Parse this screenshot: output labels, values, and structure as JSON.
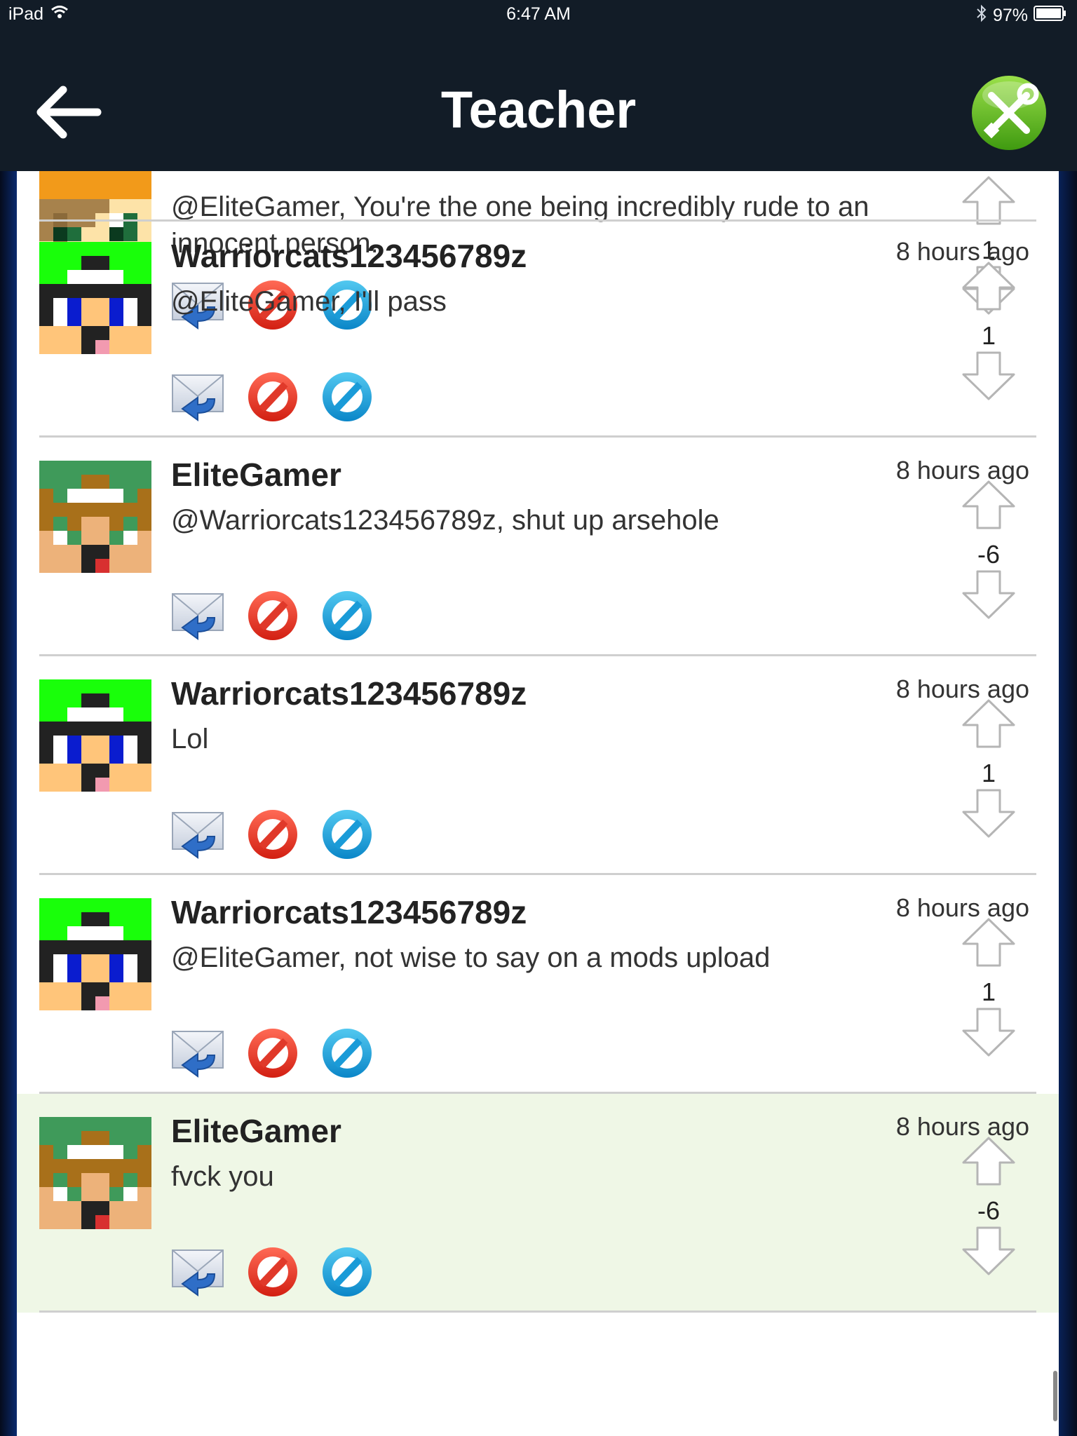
{
  "statusbar": {
    "device": "iPad",
    "time": "6:47 AM",
    "battery": "97%"
  },
  "nav": {
    "title": "Teacher"
  },
  "colors": {
    "navbar": "#121c27",
    "highlight_row": "#eff7e6",
    "tools_green": "#5cb81c"
  },
  "comments": [
    {
      "username": "",
      "time": "",
      "text": "@EliteGamer, You're the one being incredibly rude to an innocent person.",
      "score": "1",
      "avatar": "orange-hair-skin"
    },
    {
      "username": "Warriorcats123456789z",
      "time": "8 hours ago",
      "text": "@EliteGamer, I'll pass",
      "score": "1",
      "avatar": "green-hat-skin"
    },
    {
      "username": "EliteGamer",
      "time": "8 hours ago",
      "text": "@Warriorcats123456789z, shut up arsehole",
      "score": "-6",
      "avatar": "green-hair-skin"
    },
    {
      "username": "Warriorcats123456789z",
      "time": "8 hours ago",
      "text": "Lol",
      "score": "1",
      "avatar": "green-hat-skin"
    },
    {
      "username": "Warriorcats123456789z",
      "time": "8 hours ago",
      "text": "@EliteGamer, not wise to say on a mods upload",
      "score": "1",
      "avatar": "green-hat-skin"
    },
    {
      "username": "EliteGamer",
      "time": "8 hours ago",
      "text": "fvck you",
      "score": "-6",
      "avatar": "green-hair-skin"
    }
  ]
}
